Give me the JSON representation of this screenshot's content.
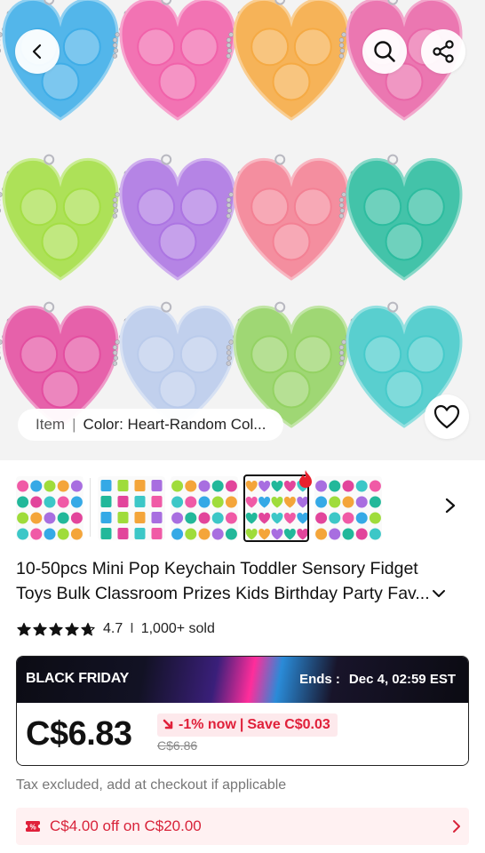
{
  "hero": {
    "sku_label": "Item",
    "sku_separator": "|",
    "sku_value": "Color: Heart-Random Col..."
  },
  "icons": {
    "back": "chevron-left-icon",
    "search": "search-icon",
    "share": "share-icon",
    "wishlist": "heart-outline-icon",
    "hot": "flame-icon",
    "next": "chevron-right-icon",
    "expand": "chevron-down-icon",
    "coupon": "coupon-icon"
  },
  "keychain_colors": [
    [
      "#35a9e6",
      "#f05aa6",
      "#f4a53a",
      "#e85fa3"
    ],
    [
      "#9fdc3b",
      "#a86ee0",
      "#f27a8e",
      "#22b89a"
    ],
    [
      "#e2459b",
      "#b6c8ea",
      "#8ed05b",
      "#3cc7c7"
    ]
  ],
  "thumbnails": [
    {
      "name": "assorted-shapes"
    },
    {
      "name": "square-grid"
    },
    {
      "name": "round-pops"
    },
    {
      "name": "hearts",
      "selected": true
    },
    {
      "name": "diamond-mix"
    }
  ],
  "product": {
    "title_line1": "10-50pcs Mini Pop Keychain Toddler Sensory Fidget",
    "title_line2": "Toys Bulk Classroom Prizes Kids Birthday Party Fav...",
    "rating": "4.7",
    "rating_divider": "I",
    "sold": "1,000+ sold",
    "stars": 4.7
  },
  "promo": {
    "label": "BLACK FRIDAY",
    "ends_label": "Ends :",
    "ends_time": "Dec 4, 02:59 EST",
    "price": "C$6.83",
    "discount": "-1% now",
    "save_separator": "|",
    "save": "Save C$0.03",
    "old_price": "C$6.86"
  },
  "tax_note": "Tax excluded, add at checkout if applicable",
  "coupon": {
    "text": "C$4.00 off on C$20.00"
  },
  "colors": {
    "accent_red": "#e0203a",
    "badge_bg": "#fde9ec",
    "coupon_bg": "#fff1f2",
    "text_dark": "#111111",
    "text_muted": "#777777"
  }
}
